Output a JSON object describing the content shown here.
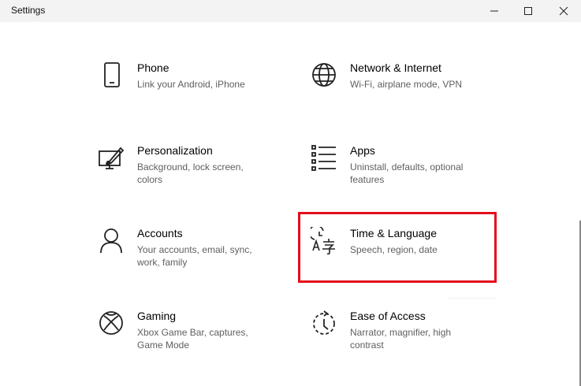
{
  "window": {
    "title": "Settings"
  },
  "controls": {
    "minimize_icon": "minimize-icon",
    "maximize_icon": "maximize-icon",
    "close_icon": "close-icon"
  },
  "tiles": [
    {
      "name": "Phone",
      "description": "Link your Android, iPhone",
      "icon": "phone-icon"
    },
    {
      "name": "Network & Internet",
      "description": "Wi-Fi, airplane mode, VPN",
      "icon": "globe-icon"
    },
    {
      "name": "Personalization",
      "description": "Background, lock screen, colors",
      "icon": "personalization-icon"
    },
    {
      "name": "Apps",
      "description": "Uninstall, defaults, optional features",
      "icon": "apps-list-icon"
    },
    {
      "name": "Accounts",
      "description": "Your accounts, email, sync, work, family",
      "icon": "person-icon"
    },
    {
      "name": "Time & Language",
      "description": "Speech, region, date",
      "icon": "time-language-icon"
    },
    {
      "name": "Gaming",
      "description": "Xbox Game Bar, captures, Game Mode",
      "icon": "xbox-icon"
    },
    {
      "name": "Ease of Access",
      "description": "Narrator, magnifier, high contrast",
      "icon": "ease-of-access-icon"
    }
  ],
  "colors": {
    "highlight": "#e30e1c",
    "titlebar": "#f3f3f3",
    "description_text": "#5f5f5f"
  }
}
